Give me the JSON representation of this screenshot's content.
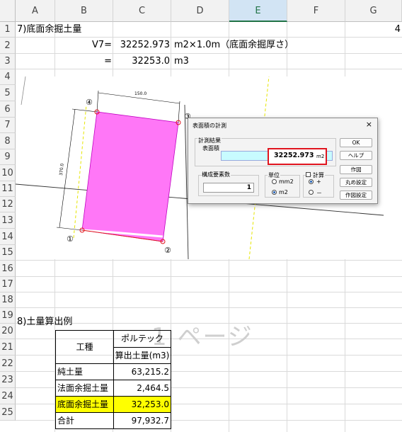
{
  "columns": [
    "A",
    "B",
    "C",
    "D",
    "E",
    "F",
    "G"
  ],
  "rows": [
    "1",
    "2",
    "3",
    "4",
    "5",
    "6",
    "7",
    "8",
    "9",
    "10",
    "11",
    "12",
    "13",
    "14",
    "15",
    "16",
    "17",
    "18",
    "19",
    "20",
    "21",
    "22",
    "23",
    "24",
    "25"
  ],
  "cells": {
    "a1": "7)底面余掘土量",
    "g1": "4",
    "b2": "V7=",
    "c2": "32252.973",
    "d2": "m2×1.0m（底面余掘厚さ）",
    "b3": "=",
    "c3": "32253.0",
    "d3": "m3",
    "a19": "8)土量算出例"
  },
  "watermark": "1 ページ",
  "drawing": {
    "labels": [
      "①",
      "②",
      "③",
      "④"
    ],
    "dim_top": "150.0",
    "dim_left": "370.0"
  },
  "table": {
    "header_left": "工種",
    "header_top": "ポルテック",
    "header_sub": "算出土量(m3)",
    "rows": [
      {
        "name": "純土量",
        "value": "63,215.2"
      },
      {
        "name": "法面余掘土量",
        "value": "2,464.5"
      },
      {
        "name": "底面余掘土量",
        "value": "32,253.0"
      },
      {
        "name": "合計",
        "value": "97,932.7"
      }
    ]
  },
  "dialog": {
    "title": "表面積の計測",
    "close": "×",
    "group_result": "計測結果",
    "surface_label": "表面積",
    "value": "32252.973",
    "unit": "m2",
    "group_count": "構成要素数",
    "count": "1",
    "group_unit": "単位",
    "unit_opt1": "mm2",
    "unit_opt2": "m2",
    "calc_label": "計算",
    "plus": "+",
    "minus": "－",
    "buttons": {
      "ok": "OK",
      "help": "ヘルプ",
      "draw": "作図",
      "round": "丸め設定",
      "draw_settings": "作図設定"
    }
  },
  "colors": {
    "highlight": "#ffff00",
    "shape_fill": "#ff77f7",
    "selected_col": "#217346",
    "result_box": "#c8fbff",
    "red_frame": "#e0141e"
  }
}
